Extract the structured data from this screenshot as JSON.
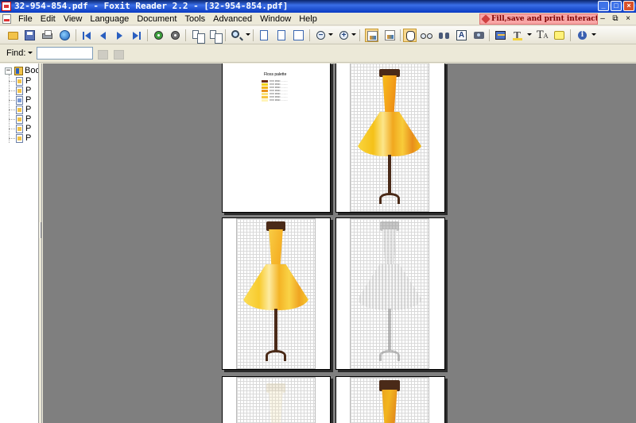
{
  "window": {
    "title": "32-954-854.pdf - Foxit Reader 2.2 - [32-954-854.pdf]"
  },
  "menu": {
    "items": [
      "File",
      "Edit",
      "View",
      "Language",
      "Document",
      "Tools",
      "Advanced",
      "Window",
      "Help"
    ]
  },
  "promo": {
    "text": "Fill,save and print interactive forms!"
  },
  "find": {
    "label": "Find:",
    "value": ""
  },
  "bookmarks": {
    "root_label": "Bool",
    "items": [
      "P",
      "P",
      "P",
      "P",
      "P",
      "P",
      "P"
    ]
  },
  "palette_page": {
    "title": "Floss palette",
    "rows": [
      {
        "color": "#6B2A10",
        "label": "XXX DMC  ..........  "
      },
      {
        "color": "#F5D21A",
        "label": "XXX DMC  ..........  "
      },
      {
        "color": "#F3B316",
        "label": "XXX DMC  ..........  "
      },
      {
        "color": "#E8921C",
        "label": "XXX DMC  ..........  "
      },
      {
        "color": "#FBE27A",
        "label": "XXX DMC  ..........  "
      },
      {
        "color": "#F6C542",
        "label": "XXX DMC  ..........  "
      },
      {
        "color": "#FFF4B8",
        "label": "XXX DMC  ..........  "
      }
    ]
  },
  "colors": {
    "titlebar": "#0A246A",
    "doc_background": "#7F7F7F",
    "dress_yellow": "#F5C118",
    "dress_orange": "#E88E1C",
    "stand_brown": "#4A2A18",
    "promo_bg": "#F8A6A6"
  },
  "icons": {
    "toolbar": [
      "open-icon",
      "save-icon",
      "print-icon",
      "email-icon",
      "first-page-icon",
      "previous-page-icon",
      "next-page-icon",
      "last-page-icon",
      "go-back-icon",
      "go-forward-icon",
      "rotate-left-icon",
      "rotate-right-icon",
      "zoom-tool-icon",
      "actual-size-icon",
      "fit-page-icon",
      "fit-width-icon",
      "zoom-out-icon",
      "zoom-in-icon",
      "bookmark-panel-icon",
      "page-thumbs-icon",
      "hand-tool-icon",
      "loupe-icon",
      "find-icon",
      "select-text-icon",
      "snapshot-icon",
      "edit-form-icon",
      "highlight-icon",
      "typewriter-icon",
      "note-icon",
      "info-icon"
    ]
  }
}
